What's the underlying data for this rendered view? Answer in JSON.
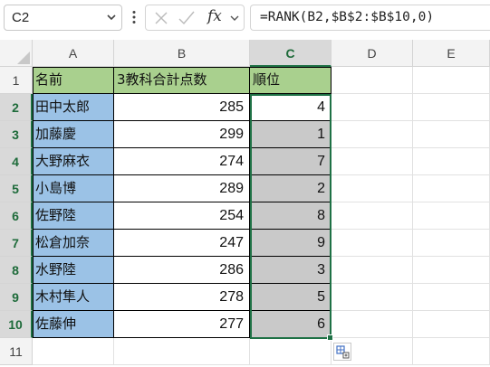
{
  "name_box": {
    "value": "C2"
  },
  "formula_bar": {
    "fx_label": "fx",
    "formula": "=RANK(B2,$B$2:$B$10,0)"
  },
  "columns": [
    "A",
    "B",
    "C",
    "D",
    "E"
  ],
  "rows": [
    "1",
    "2",
    "3",
    "4",
    "5",
    "6",
    "7",
    "8",
    "9",
    "10",
    "11"
  ],
  "headers": {
    "name": "名前",
    "score": "3教科合計点数",
    "rank": "順位"
  },
  "data": [
    {
      "name": "田中太郎",
      "score": "285",
      "rank": "4"
    },
    {
      "name": "加藤慶",
      "score": "299",
      "rank": "1"
    },
    {
      "name": "大野麻衣",
      "score": "274",
      "rank": "7"
    },
    {
      "name": "小島博",
      "score": "289",
      "rank": "2"
    },
    {
      "name": "佐野陸",
      "score": "254",
      "rank": "8"
    },
    {
      "name": "松倉加奈",
      "score": "247",
      "rank": "9"
    },
    {
      "name": "水野陸",
      "score": "286",
      "rank": "3"
    },
    {
      "name": "木村隼人",
      "score": "278",
      "rank": "5"
    },
    {
      "name": "佐藤伸",
      "score": "277",
      "rank": "6"
    }
  ],
  "colors": {
    "header_fill": "#a9d08e",
    "name_fill": "#9bc2e6",
    "rank_fill": "#c9c9c9",
    "selection": "#1e7145"
  },
  "icons": {
    "namebox_dropdown": "chevron-down-icon",
    "more": "more-vertical-icon",
    "cancel": "close-icon",
    "enter": "check-icon",
    "quick_analysis": "quick-analysis-icon"
  }
}
